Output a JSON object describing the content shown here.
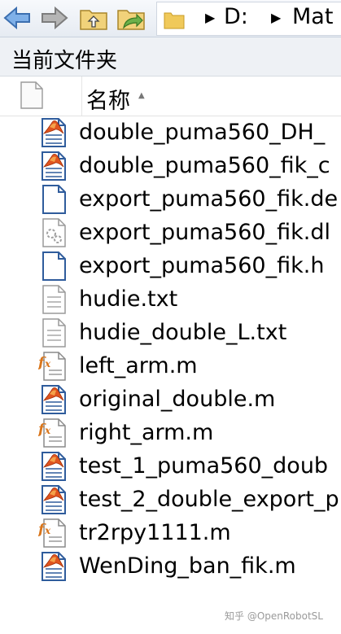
{
  "address_bar": {
    "drive": "D:",
    "subfolder": "Mat"
  },
  "panel": {
    "title": "当前文件夹"
  },
  "column_header": {
    "name_label": "名称",
    "sort_indicator": "▲"
  },
  "files": [
    {
      "name": "double_puma560_DH_",
      "icon": "matlab-script-icon"
    },
    {
      "name": "double_puma560_fik_c",
      "icon": "matlab-script-icon"
    },
    {
      "name": "export_puma560_fik.de",
      "icon": "blank-document-icon"
    },
    {
      "name": "export_puma560_fik.dl",
      "icon": "dll-file-icon"
    },
    {
      "name": "export_puma560_fik.h",
      "icon": "blank-document-icon"
    },
    {
      "name": "hudie.txt",
      "icon": "text-file-icon"
    },
    {
      "name": "hudie_double_L.txt",
      "icon": "text-file-icon"
    },
    {
      "name": "left_arm.m",
      "icon": "matlab-function-icon"
    },
    {
      "name": "original_double.m",
      "icon": "matlab-script-icon"
    },
    {
      "name": "right_arm.m",
      "icon": "matlab-function-icon"
    },
    {
      "name": "test_1_puma560_doub",
      "icon": "matlab-script-icon"
    },
    {
      "name": "test_2_double_export_p",
      "icon": "matlab-script-icon"
    },
    {
      "name": "tr2rpy1111.m",
      "icon": "matlab-function-icon"
    },
    {
      "name": "WenDing_ban_fik.m",
      "icon": "matlab-script-icon"
    }
  ],
  "watermark": "知乎 @OpenRobotSL"
}
